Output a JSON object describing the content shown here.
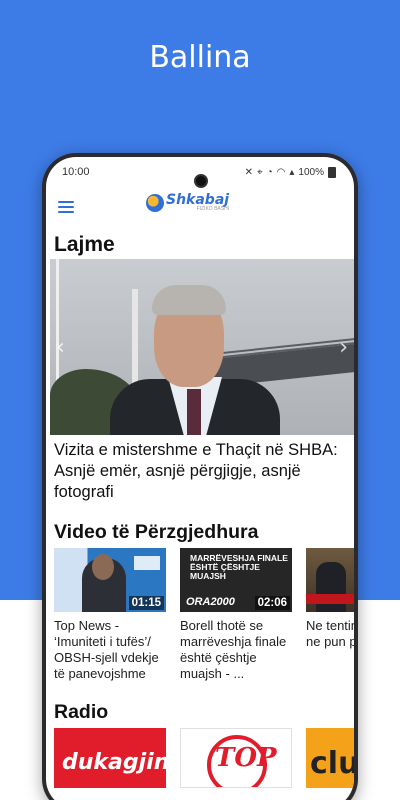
{
  "screen": {
    "title": "Ballina"
  },
  "status_bar": {
    "time": "10:00",
    "battery": "100%"
  },
  "app": {
    "logo_text": "Shkabaj",
    "logo_sub": "FIZIKO BASHI",
    "menu_icon": "hamburger-icon"
  },
  "news": {
    "section_title": "Lajme",
    "headline": "Vizita e mistershme e Thaçit në SHBA: Asnjë emër, asnjë përgjigje, asnjë fotografi",
    "prev_icon": "chevron-left-icon",
    "next_icon": "chevron-right-icon"
  },
  "videos": {
    "section_title": "Video të Përzgjedhura",
    "items": [
      {
        "duration": "01:15",
        "caption": "Top News - ‘Imuniteti i tufës’/ OBSH-sjell vdekje të panevojshme"
      },
      {
        "duration": "02:06",
        "thumb_text": "MARRËVESHJA FINALE ËSHTË ÇËSHTJE MUAJSH",
        "thumb_logo": "ORA2000",
        "caption": "Borell thotë se marrëveshja finale është çështje muajsh - ..."
      },
      {
        "duration": "",
        "caption": "Ne tentimi shtate, n ne pun per rime"
      }
    ]
  },
  "radio": {
    "section_title": "Radio",
    "items": [
      {
        "label": "dukagjini"
      },
      {
        "label": "TOP"
      },
      {
        "label": "club"
      }
    ]
  },
  "colors": {
    "background": "#3d7be6",
    "accent": "#2f6fd6",
    "brand_red": "#e21d2b"
  }
}
